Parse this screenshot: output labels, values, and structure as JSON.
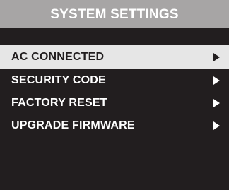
{
  "screen": {
    "title": "SYSTEM SETTINGS"
  },
  "menu": {
    "items": [
      {
        "label": "AC CONNECTED",
        "selected": true,
        "icon": "chevron-right-icon"
      },
      {
        "label": "SECURITY CODE",
        "selected": false,
        "icon": "chevron-right-icon"
      },
      {
        "label": "FACTORY RESET",
        "selected": false,
        "icon": "chevron-right-icon"
      },
      {
        "label": "UPGRADE FIRMWARE",
        "selected": false,
        "icon": "chevron-right-icon"
      }
    ]
  },
  "colors": {
    "title_background": "#a7a5a5",
    "screen_background": "#221e1f",
    "selected_background": "#e6e6e6",
    "text_on_dark": "#ffffff",
    "text_on_selected": "#221e1f"
  }
}
